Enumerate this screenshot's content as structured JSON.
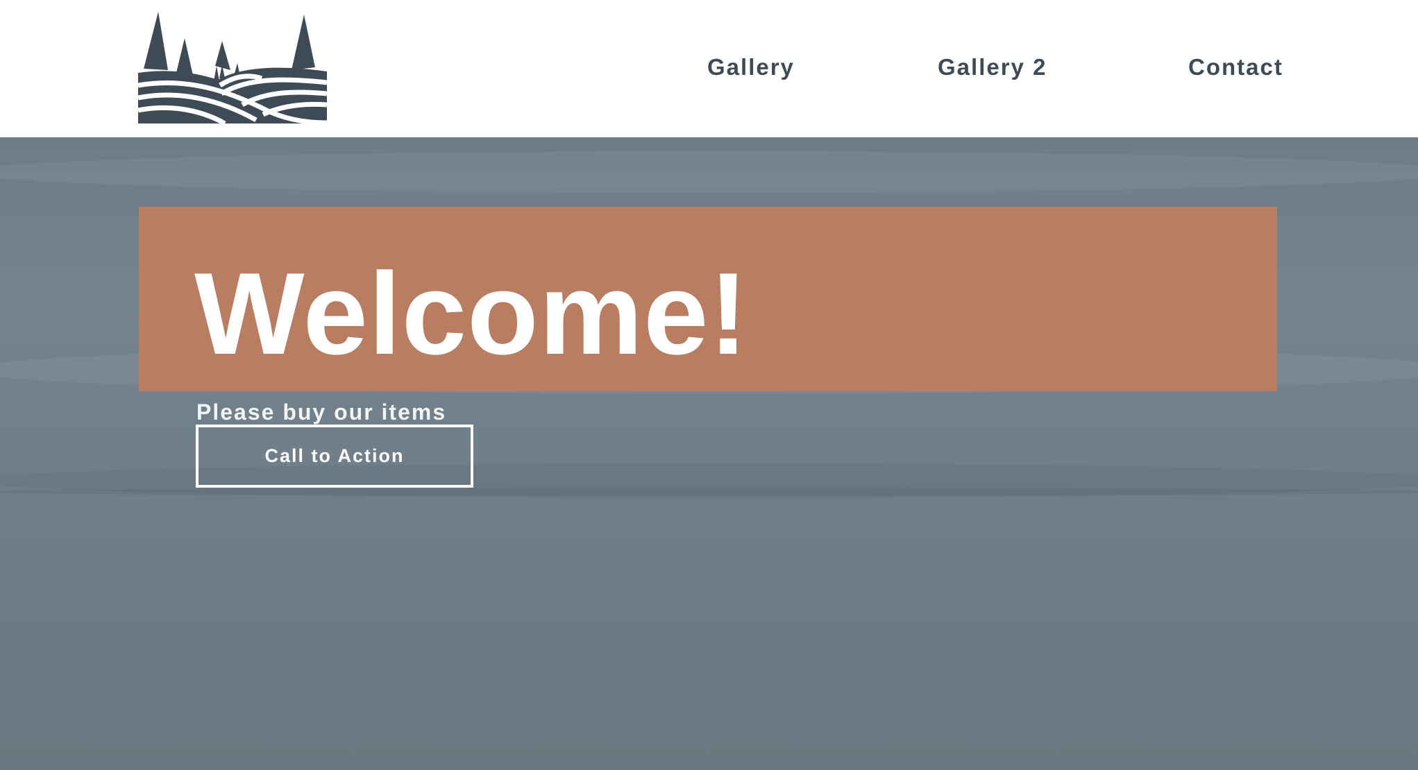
{
  "header": {
    "logo_icon": "trees-and-hills-logo-icon",
    "nav": [
      {
        "label": "Gallery"
      },
      {
        "label": "Gallery 2"
      },
      {
        "label": "Contact"
      }
    ]
  },
  "hero": {
    "title": "Welcome!",
    "subtitle": "Please buy our items",
    "cta_label": "Call to Action"
  },
  "colors": {
    "nav_text": "#3e4a56",
    "banner": "#b97d61",
    "hero_background": "#6f7e88",
    "logo": "#3e4a56"
  }
}
